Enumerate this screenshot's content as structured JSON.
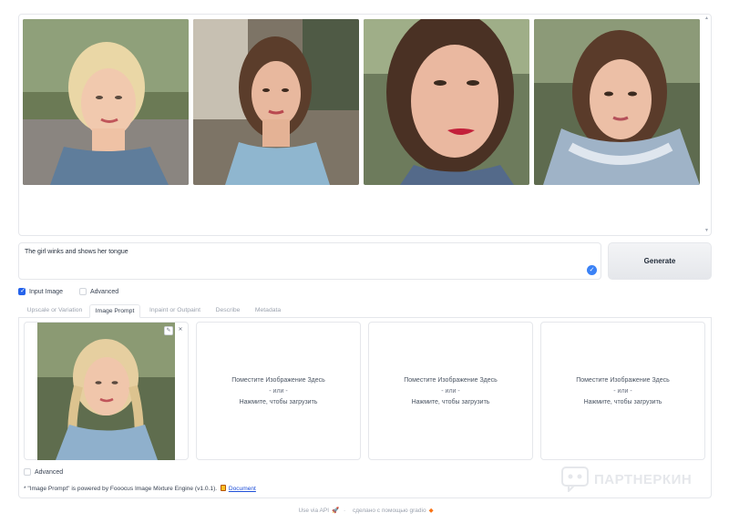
{
  "gallery": {
    "images": [
      {
        "alt": "blonde woman portrait 1"
      },
      {
        "alt": "brunette woman portrait 2"
      },
      {
        "alt": "woman close-up portrait 3"
      },
      {
        "alt": "woman in hoodie portrait 4"
      }
    ],
    "scroll_up": "▲",
    "scroll_down": "▼"
  },
  "prompt": {
    "value": "The girl winks and shows her tongue"
  },
  "generate_label": "Generate",
  "options": {
    "input_image_label": "Input Image",
    "input_image_checked": true,
    "advanced_label": "Advanced",
    "advanced_checked": false
  },
  "tabs": [
    {
      "label": "Upscale or Variation",
      "active": false
    },
    {
      "label": "Image Prompt",
      "active": true
    },
    {
      "label": "Inpaint or Outpaint",
      "active": false
    },
    {
      "label": "Describe",
      "active": false
    },
    {
      "label": "Metadata",
      "active": false
    }
  ],
  "dropzone": {
    "line1": "Поместите Изображение Здесь",
    "line2": "- или -",
    "line3": "Нажмите, чтобы загрузить"
  },
  "image_tools": {
    "edit": "✎",
    "close": "✕"
  },
  "panel_advanced_label": "Advanced",
  "powered": {
    "text": "* \"Image Prompt\" is powered by Fooocus Image Mixture Engine (v1.0.1).",
    "link": "Document"
  },
  "watermark": "ПАРТНЕРКИН",
  "footer": {
    "api": "Use via API",
    "sep": "·",
    "built": "сделано с помощью gradio"
  },
  "colors": {
    "accent": "#2563eb",
    "border": "#e5e7eb"
  }
}
